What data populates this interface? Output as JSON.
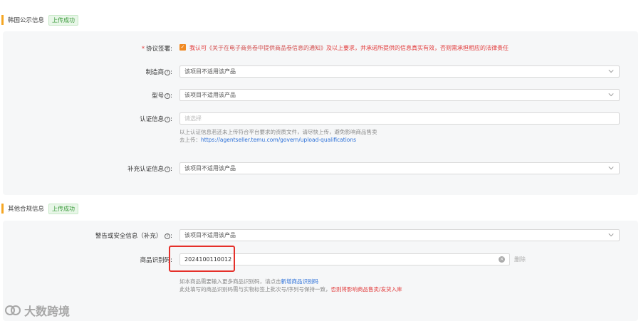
{
  "section1": {
    "title": "韩国公示信息",
    "badge": "上传成功",
    "agreement": {
      "label": "协议签署:",
      "text_prefix": "我认可",
      "link": "《关于在电子商务卷中提供商品卷信息的通知》",
      "text_suffix": "及以上要求，并承诺所提供的信息真实有效，否则需承担相应的法律责任"
    },
    "manufacturer": {
      "label": "制造商",
      "value": "该项目不适用该产品"
    },
    "model": {
      "label": "型号",
      "value": "该项目不适用该产品"
    },
    "certification": {
      "label": "认证信息",
      "placeholder": "请选择",
      "help_line1": "以上认证信息若还未上传符合平台要求的资质文件，请尽快上传，避免影响商品售卖",
      "help_line2_prefix": "去上传：",
      "help_url": "https://agentseller.temu.com/govern/upload-qualifications"
    },
    "supplementary": {
      "label": "补充认证信息",
      "value": "该项目不适用该产品"
    }
  },
  "section2": {
    "title": "其他合规信息",
    "badge": "上传成功",
    "warning": {
      "label": "警告或安全信息（补充）",
      "value": "该项目不适用该产品"
    },
    "product_code": {
      "label": "商品识别码",
      "value": "2024100110012",
      "delete_label": "删除",
      "help_line1_prefix": "如本商品需要输入更多商品识别码，请点击",
      "help_line1_link": "新增商品识别码",
      "help_line2_prefix": "此处填写的商品识别码需与实物标签上批次号/序列号保持一致，",
      "help_line2_red": "否则将影响商品售卖/发货入库"
    }
  },
  "watermark": {
    "text": "大数跨境"
  }
}
